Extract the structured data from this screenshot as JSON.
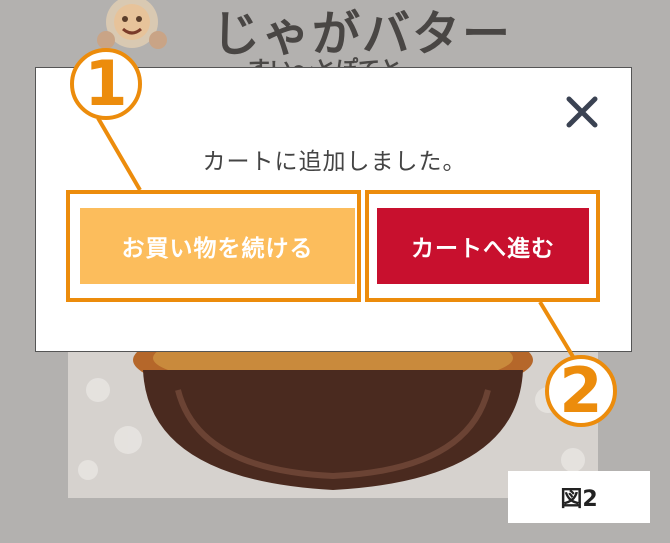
{
  "background": {
    "title": "じゃがバター",
    "subtitle": "すい～とぽてと"
  },
  "modal": {
    "message": "カートに追加しました。",
    "close_icon": "close-icon",
    "continue_label": "お買い物を続ける",
    "cart_label": "カートへ進む"
  },
  "callouts": [
    "1",
    "2"
  ],
  "figure_label": "図2",
  "colors": {
    "accent_orange": "#ec8c0c",
    "continue_button": "#fcbd5c",
    "cart_button": "#c8102e",
    "overlay": "#b3b1af"
  }
}
